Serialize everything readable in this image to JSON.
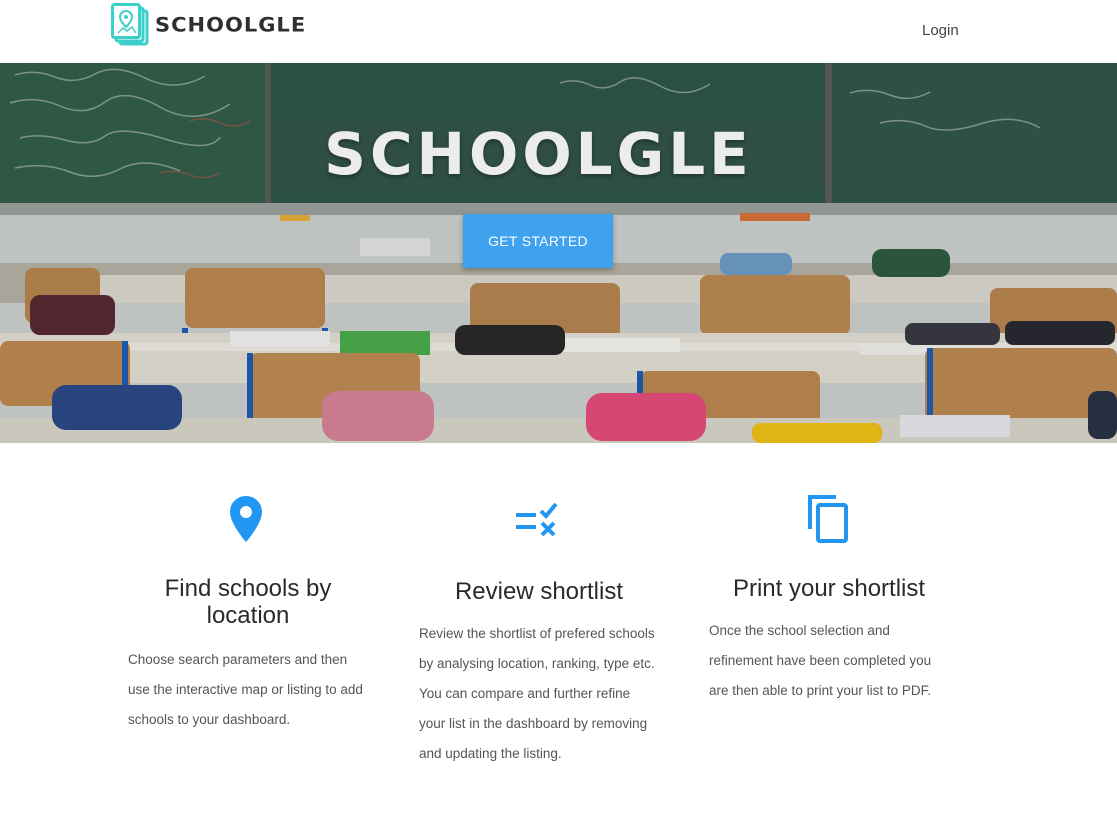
{
  "navbar": {
    "brand": "SCHOOLGLE",
    "login_label": "Login"
  },
  "hero": {
    "title": "SCHOOLGLE",
    "cta_label": "GET STARTED"
  },
  "features": [
    {
      "icon": "location-pin-icon",
      "title": "Find schools by location",
      "text": "Choose search parameters and then use the interactive map or listing to add schools to your dashboard."
    },
    {
      "icon": "checklist-icon",
      "title": "Review shortlist",
      "text": "Review the shortlist of prefered schools by analysing location, ranking, type etc. You can compare and further refine your list in the dashboard by removing and updating the listing."
    },
    {
      "icon": "copy-pages-icon",
      "title": "Print your shortlist",
      "text": "Once the school selection and refinement have been completed you are then able to print your list to PDF."
    }
  ],
  "colors": {
    "accent": "#3fa2ef",
    "icon": "#2196f3",
    "logo": "#3ccfc9"
  }
}
